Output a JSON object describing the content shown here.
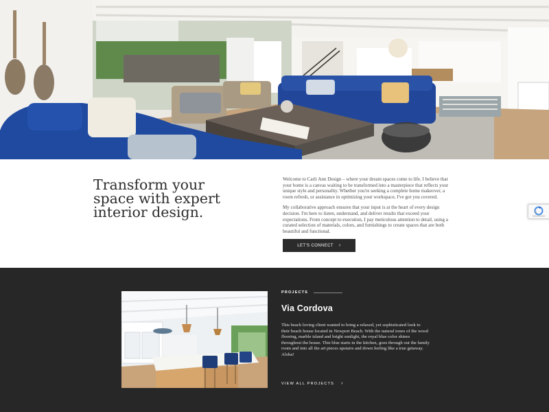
{
  "hero": {
    "image_alt": "Living room with blue sofas and an open kitchen"
  },
  "intro": {
    "headline_lines": [
      "Transform your",
      "space with expert",
      "interior design."
    ],
    "paragraphs": [
      "Welcome to Carli Ann Design – where your dream spaces come to life. I believe that your home is a canvas waiting to be transformed into a masterpiece that reflects your unique style and personality. Whether you're seeking a complete home makeover, a room refresh, or assistance in optimizing your workspace, I've got you covered.",
      "My collaborative approach ensures that your input is at the heart of every design decision. I'm here to listen, understand, and deliver results that exceed your expectations. From concept to execution, I pay meticulous attention to detail, using a curated selection of materials, colors, and furnishings to create spaces that are both beautiful and functional."
    ],
    "cta_label": "LET'S CONNECT",
    "cta_icon": "chevron-right-icon"
  },
  "projects": {
    "label": "PROJECTS",
    "title": "Via Cordova",
    "description": "This beach loving client wanted to bring a relaxed, yet sophisticated look to their beach house located in Newport Beach. With the natural tones of the wood flooring, marble island and bright sunlight, the royal blue color shines throughout the house. This blue starts in the kitchen, goes through out the family room and into all the art pieces upstairs and down feeling like a true getaway. Aloha!",
    "view_all_label": "VIEW ALL PROJECTS",
    "view_all_icon": "chevron-right-icon",
    "image_alt": "Kitchen with marble island and blue bar stools"
  },
  "colors": {
    "dark_section": "#272727",
    "button": "#2b2b2b",
    "sofa_blue": "#1f4aa0"
  }
}
